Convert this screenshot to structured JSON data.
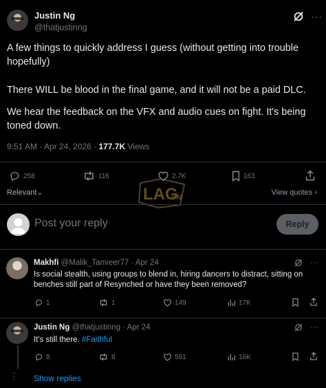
{
  "post": {
    "author_name": "Justin Ng",
    "author_handle": "@thatjustinng",
    "paragraphs": [
      "A few things to quickly address I guess (without getting into trouble hopefully)",
      "There WILL be blood in the final game, and it will not be a paid DLC.",
      "We hear the feedback on the VFX and audio cues on fight. It's being toned down."
    ],
    "time": "9:51 AM",
    "date": "Apr 24, 2026",
    "separator": "·",
    "views_count": "177.7K",
    "views_label": "Views",
    "more": "···"
  },
  "actions": {
    "replies": "258",
    "reposts": "116",
    "likes": "2.7K",
    "bookmarks": "163"
  },
  "sort": {
    "label": "Relevant",
    "view_quotes": "View quotes"
  },
  "watermark": {
    "brand": "LAG",
    "suffix": ".VN"
  },
  "composer": {
    "placeholder": "Post your reply",
    "button": "Reply"
  },
  "comments": [
    {
      "name": "Makhfi",
      "handle": "@Malik_Tanveer77",
      "date": "· Apr 24",
      "text": "Is social stealth, using groups to blend in, hiring dancers to distract, sitting on benches still part of Resynched or have they been removed?",
      "replies": "1",
      "reposts": "1",
      "likes": "149",
      "views": "17K"
    },
    {
      "name": "Justin Ng",
      "handle": "@thatjustinng",
      "date": "· Apr 24",
      "text": "It's still there. ",
      "hashtag": "#Faithful",
      "replies": "8",
      "reposts": "8",
      "likes": "591",
      "views": "16K"
    }
  ],
  "show_replies": "Show replies",
  "colors": {
    "accent": "#1d9bf0",
    "text": "#e7e9ea",
    "muted": "#71767b",
    "background": "#000000",
    "border": "#2f3336"
  }
}
